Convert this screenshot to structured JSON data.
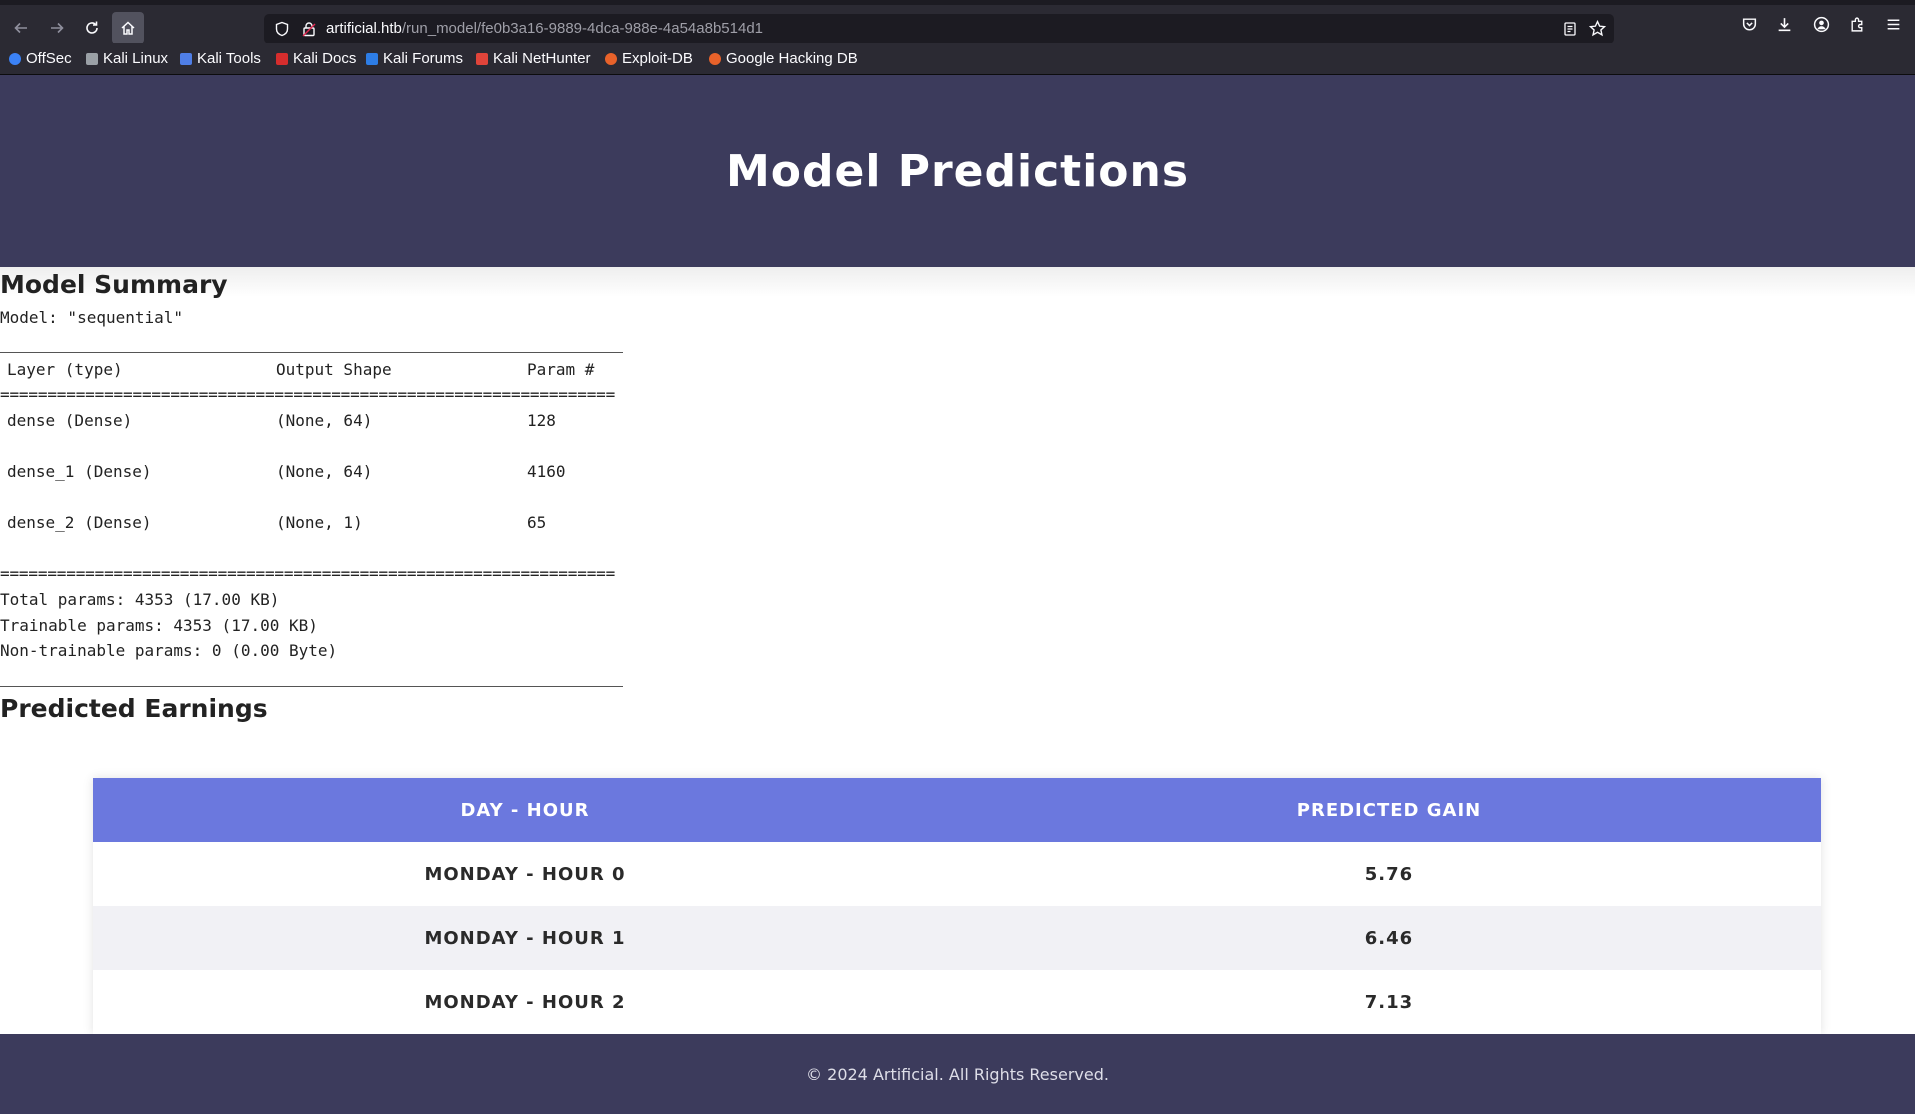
{
  "browser": {
    "url_host": "artificial.htb",
    "url_path": "/run_model/fe0b3a16-9889-4dca-988e-4a54a8b514d1",
    "bookmarks": [
      {
        "label": "OffSec",
        "icon": "offsec-icon",
        "color": "#3b82f6"
      },
      {
        "label": "Kali Linux",
        "icon": "kali-dragon-icon",
        "color": "#9aa0a6"
      },
      {
        "label": "Kali Tools",
        "icon": "kali-tools-icon",
        "color": "#4f7ee6"
      },
      {
        "label": "Kali Docs",
        "icon": "kali-docs-icon",
        "color": "#d62d2d"
      },
      {
        "label": "Kali Forums",
        "icon": "kali-forums-icon",
        "color": "#2d7de6"
      },
      {
        "label": "Kali NetHunter",
        "icon": "nethunter-icon",
        "color": "#e0443a"
      },
      {
        "label": "Exploit-DB",
        "icon": "exploit-db-icon",
        "color": "#e8622a"
      },
      {
        "label": "Google Hacking DB",
        "icon": "ghdb-icon",
        "color": "#e8622a"
      }
    ]
  },
  "header": {
    "title": "Model Predictions"
  },
  "summary": {
    "title": "Model Summary",
    "model_line": "Model: \"sequential\"",
    "columns": [
      "Layer (type)",
      "Output Shape",
      "Param #"
    ],
    "double_rule": "=================================================================",
    "layers": [
      {
        "name": "dense (Dense)",
        "shape": "(None, 64)",
        "params": "128"
      },
      {
        "name": "dense_1 (Dense)",
        "shape": "(None, 64)",
        "params": "4160"
      },
      {
        "name": "dense_2 (Dense)",
        "shape": "(None, 1)",
        "params": "65"
      }
    ],
    "total": "Total params: 4353 (17.00 KB)",
    "trainable": "Trainable params: 4353 (17.00 KB)",
    "non_trainable": "Non-trainable params: 0 (0.00 Byte)"
  },
  "earnings": {
    "title": "Predicted Earnings",
    "columns": [
      "DAY - HOUR",
      "PREDICTED GAIN"
    ],
    "rows": [
      {
        "day_hour": "MONDAY - HOUR 0",
        "gain": "5.76"
      },
      {
        "day_hour": "MONDAY - HOUR 1",
        "gain": "6.46"
      },
      {
        "day_hour": "MONDAY - HOUR 2",
        "gain": "7.13"
      }
    ]
  },
  "footer": {
    "text": "© 2024 Artificial. All Rights Reserved."
  },
  "colors": {
    "header_bg": "#3c3b5c",
    "table_header_bg": "#6b78de",
    "stripe": "#f1f1f5"
  }
}
